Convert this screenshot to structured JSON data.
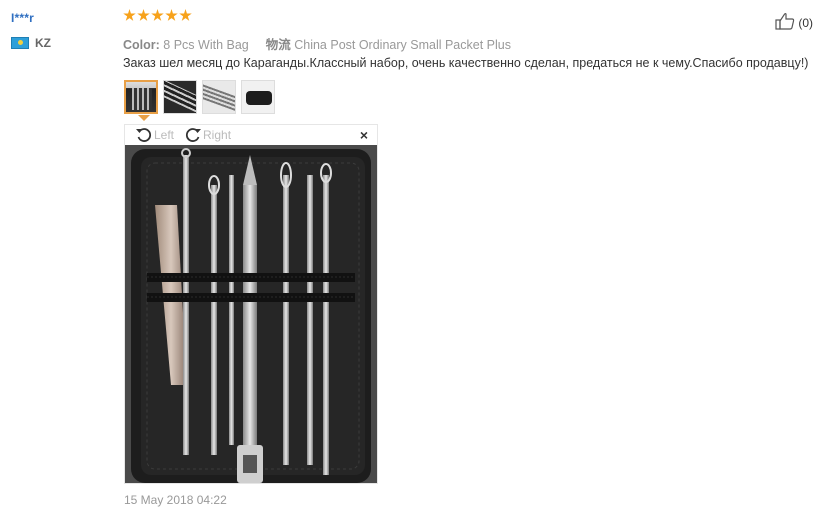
{
  "buyer": {
    "name": "I***r",
    "country": "KZ"
  },
  "rating": {
    "stars": 5,
    "max": 5
  },
  "helpful": {
    "count_label": "(0)"
  },
  "meta": {
    "color_label": "Color:",
    "color_value": "8 Pcs With Bag",
    "shipping_label": "物流",
    "shipping_value": "China Post Ordinary Small Packet Plus"
  },
  "review_text": "Заказ шел месяц до Караганды.Классный набор, очень качественно сделан, предаться не к чему.Спасибо продавцу!)",
  "photos": {
    "count": 4,
    "selected_index": 0
  },
  "viewer": {
    "rotate_left": "Left",
    "rotate_right": "Right",
    "close": "×"
  },
  "date": "15 May 2018 04:22",
  "colors": {
    "star": "#f7a21b",
    "link": "#2f6fc1",
    "selected_thumb_border": "#e8a047"
  }
}
